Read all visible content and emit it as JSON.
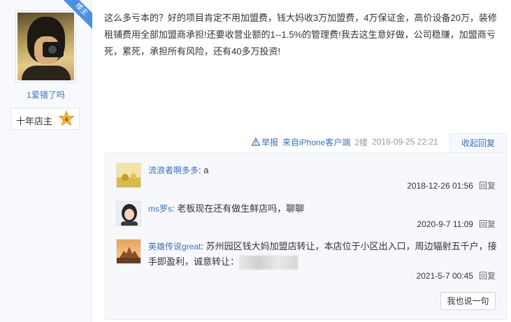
{
  "author": {
    "badge": "楼主",
    "username": "1爱错了吗",
    "rank_label": "十年店主",
    "rank_level": "4"
  },
  "post": {
    "text": "这么多亏本的？好的项目肯定不用加盟费，钱大妈收3万加盟费，4万保证金，高价设备20万，装修租铺费用全部加盟商承担!还要收营业额的1--1.5%的管理费!我去这生意好做，公司稳赚，加盟商亏死，累死，承担所有风险，还有40多万投资!"
  },
  "meta": {
    "report": "举报",
    "source": "来自iPhone客户端",
    "floor": "2楼",
    "datetime": "2018-09-25 22:21",
    "collapse": "收起回复"
  },
  "replies": [
    {
      "user": "流浪者啊多多",
      "text": "a",
      "time": "2018-12-26 01:56",
      "action": "回复"
    },
    {
      "user": "ms罗s",
      "text": "老板现在还有做生鲜店吗，聊聊",
      "time": "2020-9-7 11:09",
      "action": "回复"
    },
    {
      "user": "英雄传说great",
      "text": "苏州园区钱大妈加盟店转让，本店位于小区出入口，周边辐射五千户，接手即盈利，诚意转让：",
      "time": "2021-5-7 00:45",
      "action": "回复"
    }
  ],
  "say_button": "我也说一句",
  "colors": {
    "link": "#3d6fb8",
    "badge": "#4d8fe0",
    "panel": "#f6f8fb"
  }
}
